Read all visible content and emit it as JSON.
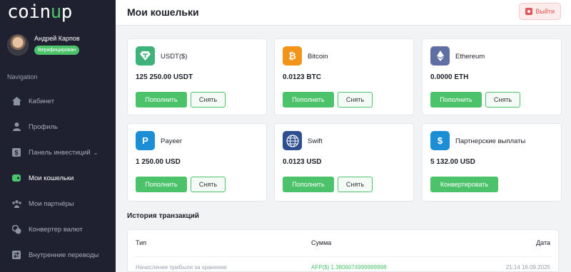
{
  "brand": {
    "logo": "coinup",
    "accent": "#4cc36a"
  },
  "user": {
    "name": "Андрей Карпов",
    "status": "Верифицирован"
  },
  "nav": {
    "title": "Navigation",
    "items": [
      {
        "label": "Кабинет",
        "icon": "home-icon"
      },
      {
        "label": "Профиль",
        "icon": "user-icon"
      },
      {
        "label": "Панель инвестиций",
        "icon": "dollar-icon"
      },
      {
        "label": "Мои кошельки",
        "icon": "wallet-icon",
        "active": true
      },
      {
        "label": "Мои партнёры",
        "icon": "partners-icon"
      },
      {
        "label": "Конвертер валют",
        "icon": "converter-icon"
      },
      {
        "label": "Внутренние переводы",
        "icon": "transfer-icon"
      }
    ]
  },
  "header": {
    "title": "Мои кошельки",
    "logout": "Выйти"
  },
  "wallets": [
    {
      "name": "USDT($)",
      "amount": "125 250.00 USDT",
      "color": "#3fb17a",
      "icon": "tether-icon",
      "deposit": "Пополнить",
      "withdraw": "Снять"
    },
    {
      "name": "Bitcoin",
      "amount": "0.0123 BTC",
      "color": "#f2931a",
      "icon": "bitcoin-icon",
      "deposit": "Пополнить",
      "withdraw": "Снять"
    },
    {
      "name": "Ethereum",
      "amount": "0.0000 ETH",
      "color": "#5f6ea3",
      "icon": "ethereum-icon",
      "deposit": "Пополнить",
      "withdraw": "Снять"
    },
    {
      "name": "Payeer",
      "amount": "1 250.00 USD",
      "color": "#1b8ed6",
      "icon": "payeer-icon",
      "deposit": "Пополнить",
      "withdraw": "Снять"
    },
    {
      "name": "Swift",
      "amount": "0.0123 USD",
      "color": "#2d4f8f",
      "icon": "swift-icon",
      "deposit": "Пополнить",
      "withdraw": "Снять"
    },
    {
      "name": "Партнерские выплаты",
      "amount": "5 132.00 USD",
      "color": "#1b8ed6",
      "icon": "dollar-icon",
      "convert": "Конвертировать"
    }
  ],
  "transactions": {
    "title": "История транзакций",
    "columns": {
      "type": "Тип",
      "amount": "Сумма",
      "date": "Дата"
    },
    "rows": [
      {
        "type": "Начисление прибыли за хранение",
        "amount": "AFP($) 1.3806074999999998",
        "date": "21:14 16.09.2025"
      }
    ]
  }
}
